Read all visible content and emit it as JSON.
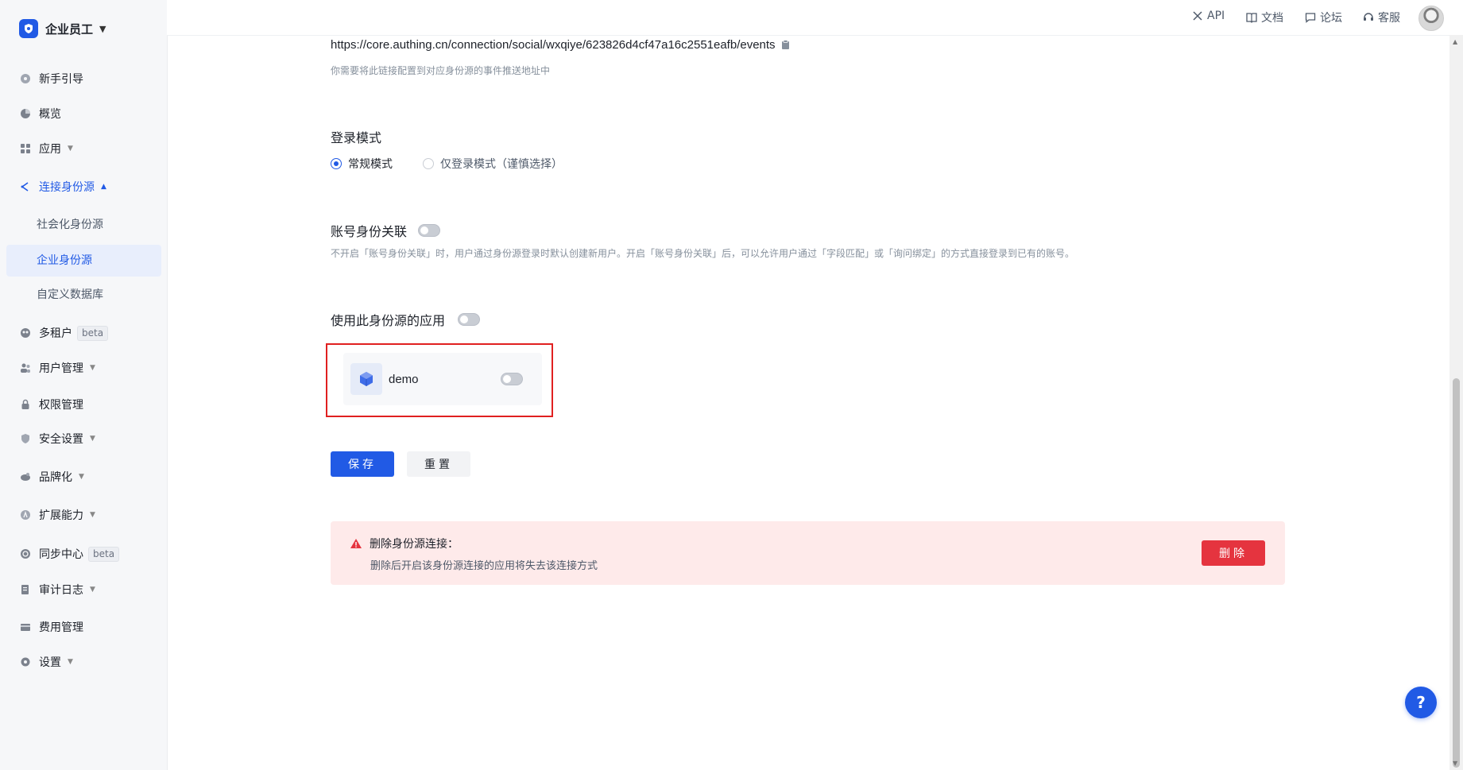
{
  "colors": {
    "primary": "#215ae5",
    "danger": "#e5343f",
    "danger_bg": "#feeaea",
    "highlight": "#e02020"
  },
  "sidebar": {
    "brand": "企业员工",
    "items": [
      {
        "label": "新手引导",
        "icon": "guide-icon"
      },
      {
        "label": "概览",
        "icon": "pie-chart-icon"
      },
      {
        "label": "应用",
        "icon": "apps-grid-icon"
      },
      {
        "label": "连接身份源",
        "icon": "connect-icon"
      },
      {
        "label": "社会化身份源"
      },
      {
        "label": "企业身份源"
      },
      {
        "label": "自定义数据库"
      },
      {
        "label": "多租户",
        "badge": "beta",
        "icon": "tenant-icon"
      },
      {
        "label": "用户管理",
        "icon": "users-icon"
      },
      {
        "label": "权限管理",
        "icon": "lock-icon"
      },
      {
        "label": "安全设置",
        "icon": "shield-icon"
      },
      {
        "label": "品牌化",
        "icon": "brand-icon"
      },
      {
        "label": "扩展能力",
        "icon": "extension-icon"
      },
      {
        "label": "同步中心",
        "badge": "beta",
        "icon": "sync-icon"
      },
      {
        "label": "审计日志",
        "icon": "log-icon"
      },
      {
        "label": "费用管理",
        "icon": "billing-icon"
      },
      {
        "label": "设置",
        "icon": "gear-icon"
      }
    ]
  },
  "topbar": {
    "api": "API",
    "docs": "文档",
    "forum": "论坛",
    "support": "客服"
  },
  "main": {
    "event_url": "https://core.authing.cn/connection/social/wxqiye/623826d4cf47a16c2551eafb/events",
    "event_hint": "你需要将此链接配置到对应身份源的事件推送地址中",
    "login_mode_title": "登录模式",
    "login_mode_options": [
      "常规模式",
      "仅登录模式（谨慎选择）"
    ],
    "login_mode_selected": "常规模式",
    "account_link_title": "账号身份关联",
    "account_link_enabled": false,
    "account_link_hint": "不开启「账号身份关联」时，用户通过身份源登录时默认创建新用户。开启「账号身份关联」后，可以允许用户通过「字段匹配」或「询问绑定」的方式直接登录到已有的账号。",
    "apps_title": "使用此身份源的应用",
    "apps_enabled": false,
    "apps": [
      {
        "name": "demo",
        "enabled": false
      }
    ],
    "save_label": "保存",
    "reset_label": "重置",
    "delete_panel": {
      "title": "删除身份源连接：",
      "description": "删除后开启该身份源连接的应用将失去该连接方式",
      "delete_label": "删除"
    }
  },
  "help_label": "?"
}
